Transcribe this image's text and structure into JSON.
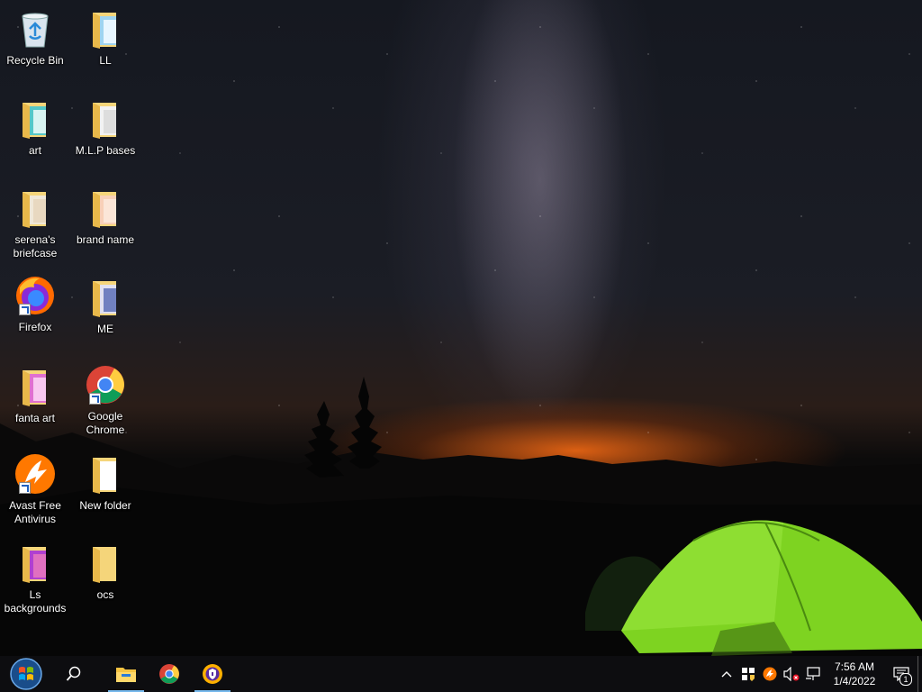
{
  "desktop": {
    "icons": [
      {
        "label": "Recycle Bin",
        "icon": "recycle-bin-icon"
      },
      {
        "label": "LL",
        "icon": "folder-icon"
      },
      {
        "label": "art",
        "icon": "folder-icon"
      },
      {
        "label": "M.L.P bases",
        "icon": "folder-icon"
      },
      {
        "label": "serena's briefcase",
        "icon": "folder-icon"
      },
      {
        "label": "brand name",
        "icon": "folder-icon"
      },
      {
        "label": "Firefox",
        "icon": "firefox-icon",
        "shortcut": true
      },
      {
        "label": "ME",
        "icon": "folder-icon"
      },
      {
        "label": "fanta art",
        "icon": "folder-icon"
      },
      {
        "label": "Google Chrome",
        "icon": "chrome-icon",
        "shortcut": true
      },
      {
        "label": "Avast Free Antivirus",
        "icon": "avast-icon",
        "shortcut": true
      },
      {
        "label": "New folder",
        "icon": "folder-icon"
      },
      {
        "label": "Ls backgrounds",
        "icon": "folder-icon"
      },
      {
        "label": "ocs",
        "icon": "folder-icon"
      }
    ]
  },
  "taskbar": {
    "start": "start-button",
    "search": "search-icon",
    "pinned": [
      {
        "name": "file-explorer",
        "active": true
      },
      {
        "name": "google-chrome",
        "active": false
      },
      {
        "name": "avast-secure-browser",
        "active": true
      }
    ],
    "tray": {
      "icons": [
        "chevron-up-icon",
        "security-shield-icon",
        "avast-tray-icon",
        "volume-muted-icon",
        "network-icon"
      ],
      "time": "7:56 AM",
      "date": "1/4/2022",
      "notification_count": "1"
    }
  },
  "colors": {
    "taskbar_bg": "#0d0d10",
    "active_indicator": "#76b9ed",
    "tent_green": "#7ed321",
    "sunset_orange": "#ff6e14"
  }
}
